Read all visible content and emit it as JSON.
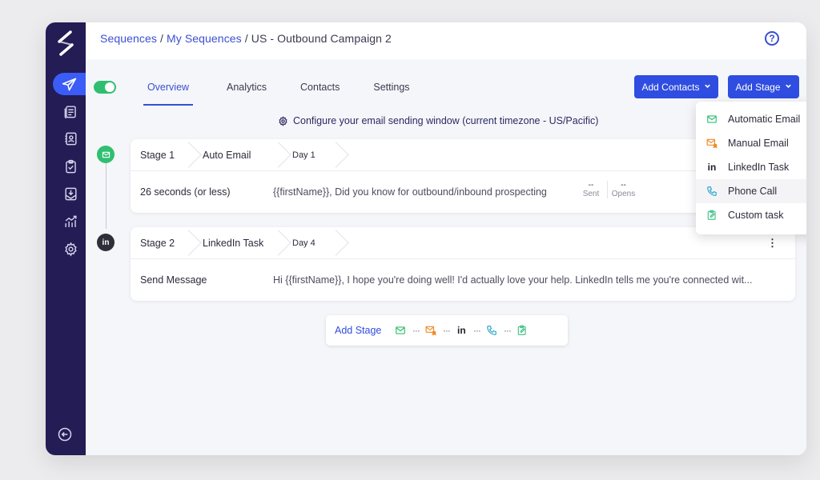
{
  "breadcrumb": {
    "link1": "Sequences",
    "sep1": "/",
    "link2": "My Sequences",
    "sep2": "/",
    "current": "US - Outbound Campaign 2"
  },
  "help": "?",
  "tabs": {
    "overview": "Overview",
    "analytics": "Analytics",
    "contacts": "Contacts",
    "settings": "Settings"
  },
  "buttons": {
    "add_contacts": "Add Contacts",
    "add_stage": "Add Stage"
  },
  "config_note": "Configure your email sending window (current timezone - US/Pacific)",
  "stages": [
    {
      "stage": "Stage 1",
      "type": "Auto Email",
      "day": "Day 1",
      "delay": "26 seconds (or less)",
      "message": "{{firstName}}, Did you know for outbound/inbound prospecting",
      "stats": [
        {
          "value": "--",
          "label": "Sent"
        },
        {
          "value": "--",
          "label": "Opens"
        }
      ]
    },
    {
      "stage": "Stage 2",
      "type": "LinkedIn Task",
      "day": "Day 4",
      "action": "Send Message",
      "message": "Hi {{firstName}}, I hope you're doing well! I'd actually love your help. LinkedIn tells me you're connected wit...",
      "kebab": "⋮"
    }
  ],
  "add_stage_bar": {
    "label": "Add Stage",
    "dots": "···"
  },
  "dropdown": [
    {
      "label": "Automatic Email",
      "icon": "email-icon"
    },
    {
      "label": "Manual Email",
      "icon": "manual-email-icon"
    },
    {
      "label": "LinkedIn Task",
      "icon": "linkedin-icon",
      "submenu": "›"
    },
    {
      "label": "Phone Call",
      "icon": "phone-icon"
    },
    {
      "label": "Custom task",
      "icon": "task-icon"
    }
  ],
  "linkedin_short": "in",
  "colors": {
    "sidebar": "#231c55",
    "accent": "#2f4de0",
    "green": "#2fbf71",
    "orange": "#f08a24",
    "teal": "#2aa6c9"
  }
}
